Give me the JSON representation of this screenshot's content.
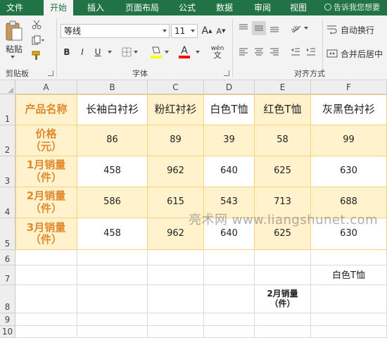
{
  "tabs": [
    {
      "label": "文件",
      "active": false
    },
    {
      "label": "开始",
      "active": true
    },
    {
      "label": "插入",
      "active": false
    },
    {
      "label": "页面布局",
      "active": false
    },
    {
      "label": "公式",
      "active": false
    },
    {
      "label": "数据",
      "active": false
    },
    {
      "label": "审阅",
      "active": false
    },
    {
      "label": "视图",
      "active": false
    }
  ],
  "tell_me": "告诉我您想要",
  "clipboard": {
    "paste_label": "粘贴",
    "group_label": "剪贴板"
  },
  "font": {
    "name": "等线",
    "size": "11",
    "bold": "B",
    "italic": "I",
    "underline": "U",
    "grow": "A",
    "shrink": "A",
    "color_letter": "A",
    "phonetic": "wén",
    "group_label": "字体",
    "fill_color": "#ffff00",
    "font_color": "#ff0000"
  },
  "alignment": {
    "wrap_text": "自动换行",
    "merge_center": "合并后居中",
    "group_label": "对齐方式"
  },
  "columns": [
    "A",
    "B",
    "C",
    "D",
    "E",
    "F"
  ],
  "rows": [
    "1",
    "2",
    "3",
    "4",
    "5",
    "6",
    "7",
    "8",
    "9",
    "10"
  ],
  "table": {
    "corner": "产品名称",
    "products": [
      "长袖白衬衫",
      "粉红衬衫",
      "白色T恤",
      "红色T恤",
      "灰黑色衬衫"
    ],
    "rows": [
      {
        "label": "价格（元）",
        "values": [
          "86",
          "89",
          "39",
          "58",
          "99"
        ]
      },
      {
        "label": "1月销量（件）",
        "values": [
          "458",
          "962",
          "640",
          "625",
          "630"
        ]
      },
      {
        "label": "2月销量（件）",
        "values": [
          "586",
          "615",
          "543",
          "713",
          "688"
        ]
      },
      {
        "label": "3月销量（件）",
        "values": [
          "458",
          "962",
          "640",
          "625",
          "630"
        ]
      }
    ]
  },
  "extra_cells": {
    "f7": "白色T恤",
    "e8": "2月销量（件）"
  },
  "watermark": "亮术网 www.liangshunet.com",
  "colors": {
    "ribbon_green": "#217346",
    "table_fill": "#fff2cc",
    "table_border": "#f5d27a",
    "label_orange": "#e0892e"
  }
}
